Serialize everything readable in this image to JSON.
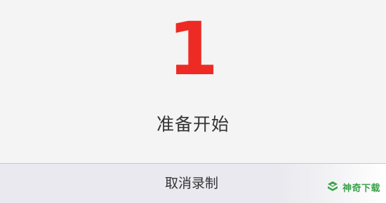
{
  "countdown": {
    "number": "1",
    "message": "准备开始"
  },
  "cancel_button": {
    "label": "取消录制"
  },
  "watermark": {
    "text": "神奇下载"
  },
  "colors": {
    "countdown_number": "#ee2a24",
    "text": "#333333",
    "panel_background": "#f4f4f4",
    "button_background": "#e9e9ef",
    "watermark": "#3aa34a"
  }
}
